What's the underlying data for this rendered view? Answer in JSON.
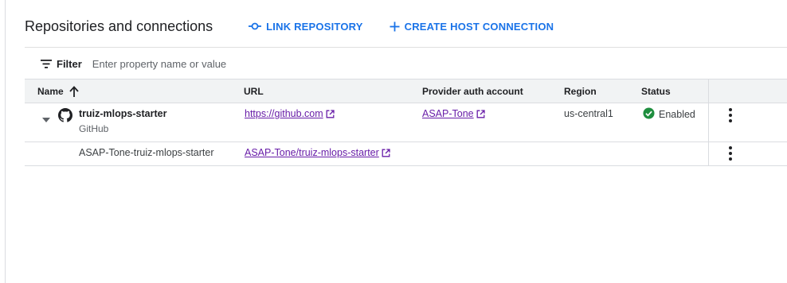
{
  "header": {
    "title": "Repositories and connections",
    "link_repository_label": "LINK REPOSITORY",
    "create_host_connection_label": "CREATE HOST CONNECTION"
  },
  "filter": {
    "label": "Filter",
    "placeholder": "Enter property name or value"
  },
  "table": {
    "columns": {
      "name": "Name",
      "url": "URL",
      "auth": "Provider auth account",
      "region": "Region",
      "status": "Status"
    },
    "sort": {
      "column": "Name",
      "direction": "ascending"
    },
    "connection": {
      "name": "truiz-mlops-starter",
      "provider": "GitHub",
      "url": "https://github.com",
      "auth_account": "ASAP-Tone",
      "region": "us-central1",
      "status": "Enabled",
      "expanded": true
    },
    "repositories": [
      {
        "name": "ASAP-Tone-truiz-mlops-starter",
        "url": "ASAP-Tone/truiz-mlops-starter"
      }
    ]
  },
  "colors": {
    "accent": "#1a73e8",
    "link_visited": "#681da8",
    "status_ok": "#1e8e3e",
    "header_bg": "#f1f3f4"
  },
  "icons": {
    "link_repository": "link-repo-icon",
    "create_host": "plus-icon",
    "filter": "filter-icon",
    "sort": "arrow-up-icon",
    "expand": "caret-down-icon",
    "provider": "github-icon",
    "external": "external-link-icon",
    "status": "check-circle-icon",
    "menu": "more-vert-icon"
  }
}
